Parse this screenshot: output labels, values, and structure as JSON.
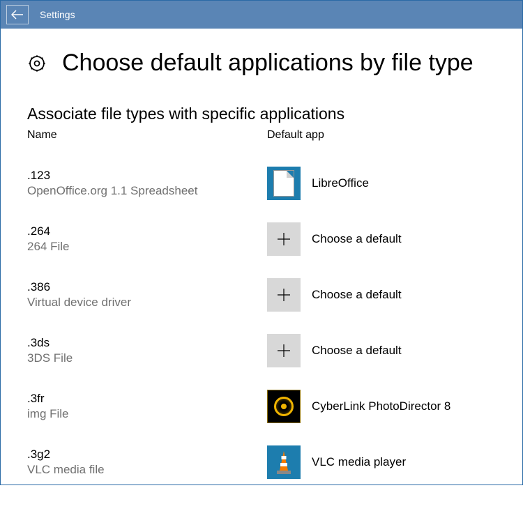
{
  "titlebar": {
    "title": "Settings"
  },
  "page": {
    "title": "Choose default applications by file type",
    "subtitle": "Associate file types with specific applications"
  },
  "columns": {
    "name": "Name",
    "default_app": "Default app"
  },
  "rows": [
    {
      "ext": ".123",
      "desc": "OpenOffice.org 1.1 Spreadsheet",
      "app": "LibreOffice",
      "icon": "libre"
    },
    {
      "ext": ".264",
      "desc": "264 File",
      "app": "Choose a default",
      "icon": "plus"
    },
    {
      "ext": ".386",
      "desc": "Virtual device driver",
      "app": "Choose a default",
      "icon": "plus"
    },
    {
      "ext": ".3ds",
      "desc": "3DS File",
      "app": "Choose a default",
      "icon": "plus"
    },
    {
      "ext": ".3fr",
      "desc": "img File",
      "app": "CyberLink PhotoDirector 8",
      "icon": "cyberlink"
    },
    {
      "ext": ".3g2",
      "desc": "VLC media file",
      "app": "VLC media player",
      "icon": "vlc"
    }
  ]
}
